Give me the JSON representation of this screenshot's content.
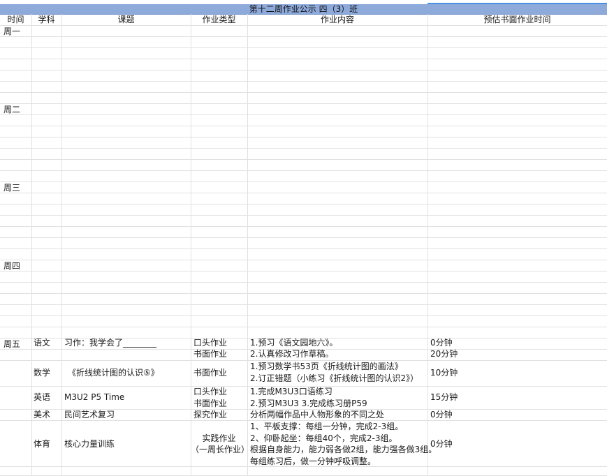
{
  "title": "第十二周作业公示 四（3）班",
  "headers": {
    "time": "时间",
    "subject": "学科",
    "topic": "课题",
    "type": "作业类型",
    "content": "作业内容",
    "est_time": "预估书面作业时间"
  },
  "days": {
    "mon": "周一",
    "tue": "周二",
    "wed": "周三",
    "thu": "周四",
    "fri": "周五"
  },
  "friday": {
    "chinese": {
      "subject": "语文",
      "topic": "习作：我学会了________",
      "type1": "口头作业",
      "content1": "1.预习《语文园地六》。",
      "time1": "0分钟",
      "type2": "书面作业",
      "content2": "2.认真修改习作草稿。",
      "time2": "20分钟"
    },
    "math": {
      "subject": "数学",
      "topic": "《折线统计图的认识⑤》",
      "type": "书面作业",
      "content1": "1.预习数学书53页《折线统计图的画法》",
      "content2": "2.订正错题（小练习《折线统计图的认识2》）",
      "time": "10分钟"
    },
    "english": {
      "subject": "英语",
      "topic": "M3U2 P5 Time",
      "type1": "口头作业",
      "type2": "书面作业",
      "content1": "1.完成M3U3口语练习",
      "content2": "2.预习M3U3  3.完成练习册P59",
      "time": "15分钟"
    },
    "art": {
      "subject": "美术",
      "topic": "民间艺术复习",
      "type": "探究作业",
      "content": "分析两幅作品中人物形象的不同之处",
      "time": "0分钟"
    },
    "pe": {
      "subject": "体育",
      "topic": "核心力量训练",
      "type1": "实践作业",
      "type2": "（一周长作业）",
      "content1": "1、平板支撑：每组一分钟，完成2-3组。",
      "content2": "2、仰卧起坐：每组40个，完成2-3组。",
      "content3": "根据自身能力，能力弱各做2组，能力强各做3组。",
      "content4": "每组练习后，做一分钟呼吸调整。",
      "time": "0分钟"
    }
  }
}
